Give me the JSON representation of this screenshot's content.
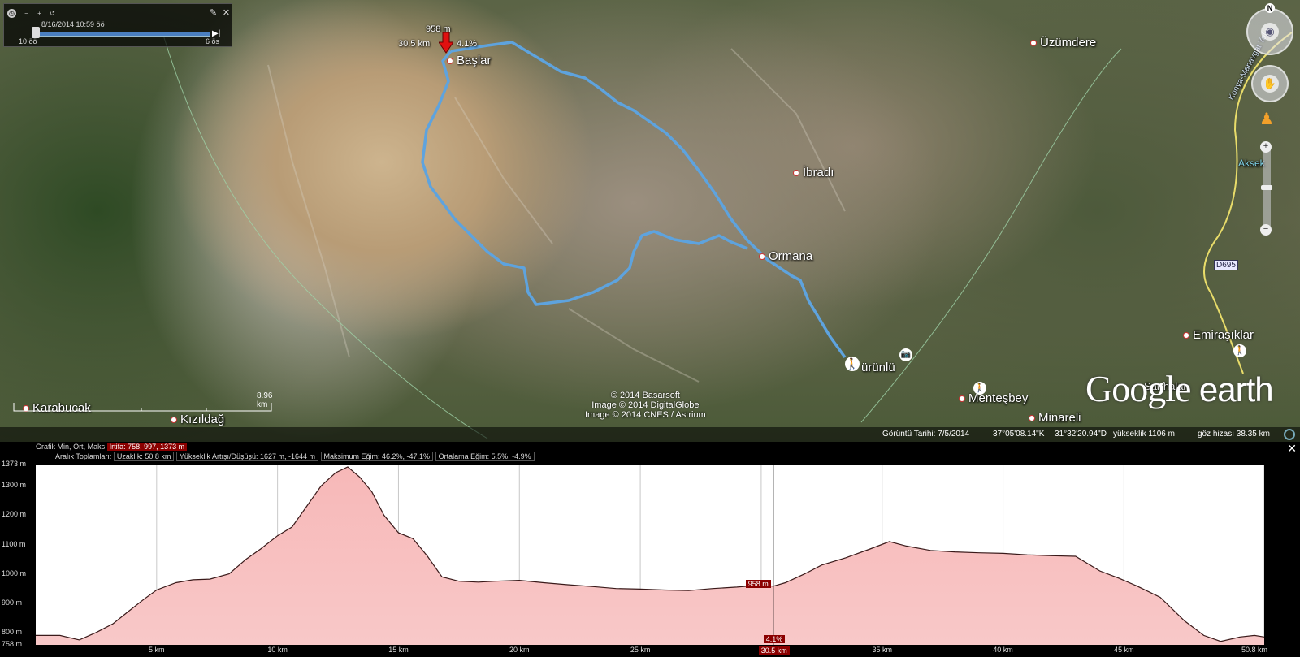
{
  "tour": {
    "date_time": "8/16/2014  10:59 öö",
    "start_label": "10 öö",
    "end_label": "6 ös"
  },
  "places": [
    {
      "name": "Başlar"
    },
    {
      "name": "Üzümdere"
    },
    {
      "name": "İbradı"
    },
    {
      "name": "Ormana"
    },
    {
      "name": "Karabucak"
    },
    {
      "name": "Kızıldağ"
    },
    {
      "name": "ürünlü"
    },
    {
      "name": "Menteşbey"
    },
    {
      "name": "Minareli"
    },
    {
      "name": "Emiraşıklar"
    },
    {
      "name": "Sarıhalar"
    },
    {
      "name": "Aksek"
    },
    {
      "name": "Konya-Manavgat Yolu"
    },
    {
      "name": "D695"
    }
  ],
  "marker": {
    "elevation": "958 m",
    "distance": "30.5 km",
    "slope": "4.1%"
  },
  "credits": [
    "© 2014 Basarsoft",
    "Image © 2014 DigitalGlobe",
    "Image © 2014 CNES / Astrium"
  ],
  "logo": {
    "google": "Google",
    "earth": "earth"
  },
  "scale_label": "8.96 km",
  "status": {
    "imagery_date": "Görüntü Tarihi: 7/5/2014",
    "lat": "37°05'08.14\"K",
    "lon": "31°32'20.94\"D",
    "elev": "yükseklik  1106 m",
    "eye": "göz hizası  38.35 km"
  },
  "profile": {
    "graph_label": "Grafik",
    "min_label": "Min",
    "avg_label": "Ort",
    "max_label": "Maks",
    "altitude_stat": "İrtifa: 758, 997, 1373 m",
    "range_totals_label": "Aralık Toplamları:",
    "distance_stat": "Uzaklık: 50.8 km",
    "gain_loss_stat": "Yükseklik Artışı/Düşüşü: 1627 m, -1644 m",
    "max_slope_stat": "Maksimum Eğim: 46.2%, -47.1%",
    "avg_slope_stat": "Ortalama Eğim: 5.5%, -4.9%",
    "cursor_elev": "958 m",
    "cursor_dist": "30.5 km",
    "cursor_slope": "4.1%",
    "close": "✕"
  },
  "chart_data": {
    "type": "area",
    "x_unit": "km",
    "y_unit": "m",
    "xlim": [
      0,
      50.8
    ],
    "ylim": [
      758,
      1373
    ],
    "yticks": [
      "1373 m",
      "1300 m",
      "1200 m",
      "1100 m",
      "1000 m",
      "900 m",
      "800 m",
      "758 m"
    ],
    "ytick_values": [
      1373,
      1300,
      1200,
      1100,
      1000,
      900,
      800,
      758
    ],
    "xticks": [
      "5 km",
      "10 km",
      "15 km",
      "20 km",
      "25 km",
      "30 km",
      "35 km",
      "40 km",
      "45 km",
      "50.8 km"
    ],
    "xtick_values": [
      5,
      10,
      15,
      20,
      25,
      30,
      35,
      40,
      45,
      50.8
    ],
    "x": [
      0,
      1,
      1.8,
      2.5,
      3.2,
      3.8,
      4.5,
      5,
      5.8,
      6.5,
      7.2,
      8,
      8.7,
      9.3,
      10,
      10.6,
      11.2,
      11.8,
      12.4,
      12.9,
      13.4,
      13.9,
      14.4,
      15,
      15.6,
      16.2,
      16.8,
      17.5,
      18.3,
      19,
      20,
      21,
      22,
      23,
      24,
      25,
      26,
      27,
      28,
      29,
      30,
      30.5,
      31,
      31.8,
      32.5,
      33.5,
      34.5,
      35.3,
      36,
      37,
      38,
      39,
      40,
      41,
      42,
      43,
      44,
      44.8,
      45.5,
      46.5,
      47.5,
      48.3,
      49,
      49.8,
      50.4,
      50.8
    ],
    "y": [
      790,
      790,
      775,
      800,
      830,
      870,
      915,
      945,
      970,
      980,
      982,
      1000,
      1050,
      1085,
      1130,
      1160,
      1230,
      1300,
      1345,
      1365,
      1330,
      1280,
      1200,
      1140,
      1120,
      1060,
      990,
      975,
      972,
      975,
      978,
      970,
      963,
      957,
      950,
      948,
      945,
      943,
      950,
      955,
      962,
      958,
      970,
      1000,
      1030,
      1055,
      1085,
      1110,
      1095,
      1080,
      1075,
      1072,
      1070,
      1065,
      1062,
      1060,
      1010,
      985,
      960,
      920,
      840,
      790,
      770,
      785,
      790,
      785
    ]
  }
}
